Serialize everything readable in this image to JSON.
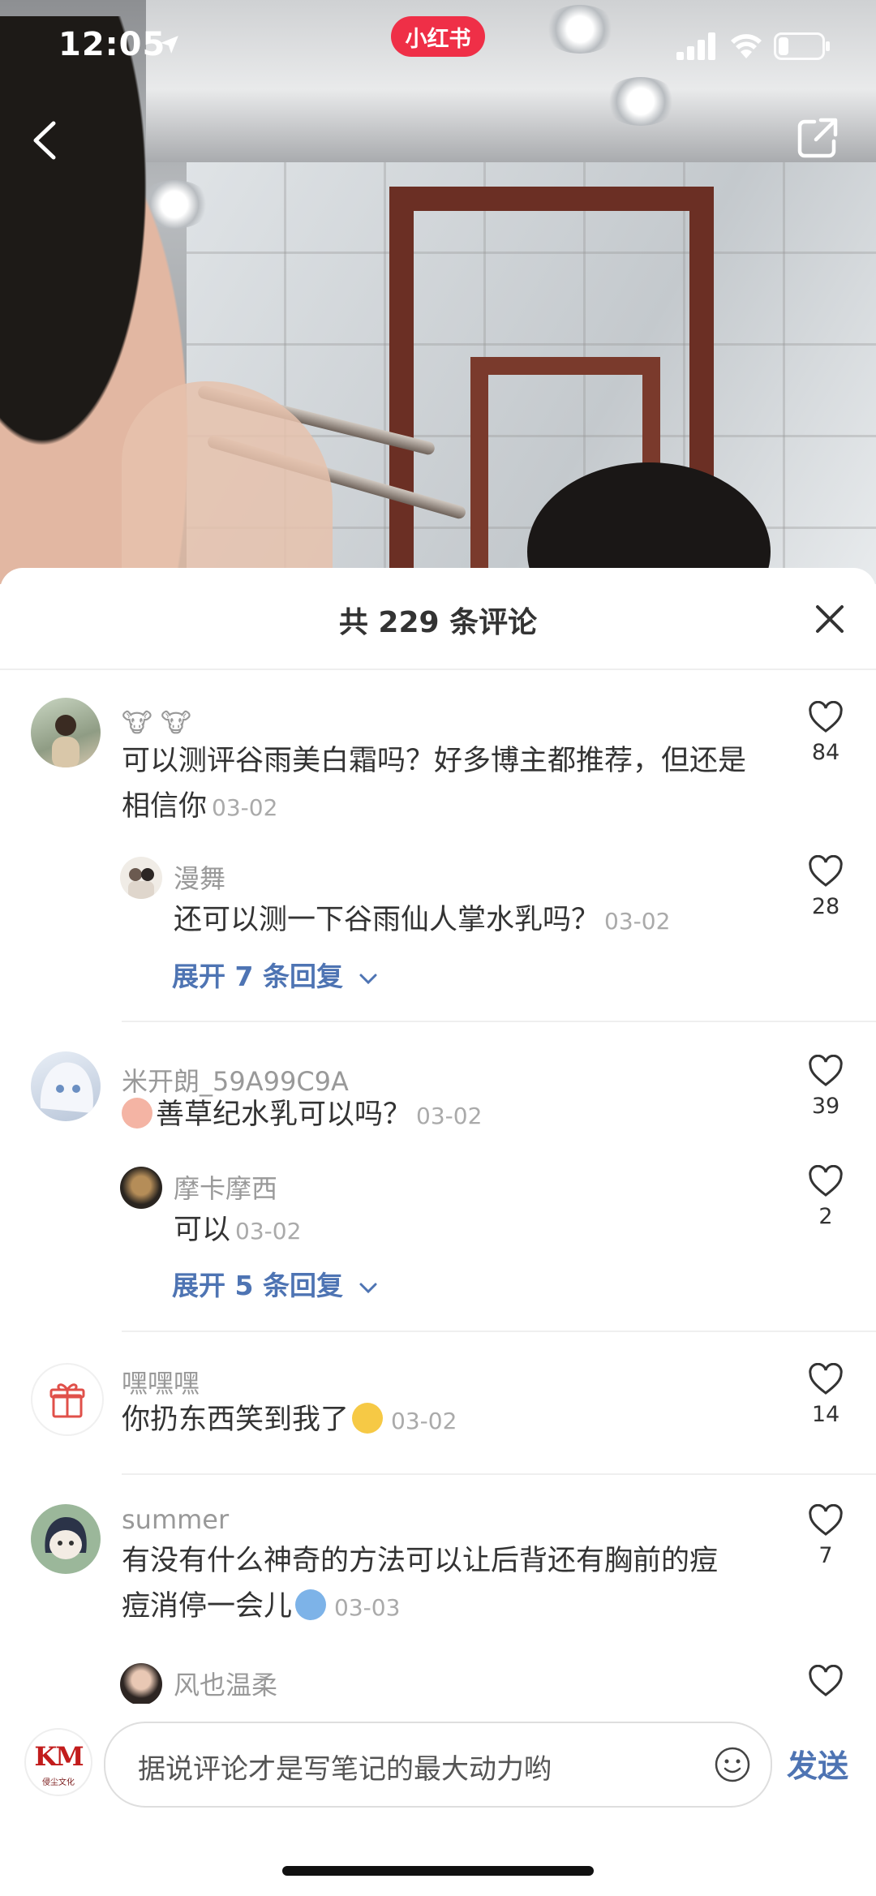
{
  "status_bar": {
    "time": "12:05",
    "brand": "小红书"
  },
  "sheet": {
    "title": "共 229 条评论"
  },
  "comments": [
    {
      "name": "🐮 🐮",
      "text": "可以测评谷雨美白霜吗？好多博主都推荐，但还是相信你",
      "date": "03-02",
      "likes": "84",
      "reply": {
        "name": "漫舞",
        "text": "还可以测一下谷雨仙人掌水乳吗？",
        "date": "03-02",
        "likes": "28"
      },
      "expand": "展开 7 条回复"
    },
    {
      "name": "米开朗_59A99C9A",
      "text": "善草纪水乳可以吗？",
      "date": "03-02",
      "likes": "39",
      "reply": {
        "name": "摩卡摩西",
        "text": "可以",
        "date": "03-02",
        "likes": "2"
      },
      "expand": "展开 5 条回复"
    },
    {
      "name": "嘿嘿嘿",
      "text": "你扔东西笑到我了",
      "date": "03-02",
      "likes": "14"
    },
    {
      "name": "summer",
      "text_line1": "有没有什么神奇的方法可以让后背还有胸前的痘",
      "text_line2": "痘消停一会儿",
      "date": "03-03",
      "likes": "7",
      "reply": {
        "name": "风也温柔"
      }
    }
  ],
  "input": {
    "placeholder": "据说评论才是写笔记的最大动力哟",
    "send_label": "发送",
    "avatar_logo": "KM",
    "avatar_sub": "侵尘文化"
  },
  "colors": {
    "brand": "#ef2f47",
    "link": "#4e74b3"
  }
}
